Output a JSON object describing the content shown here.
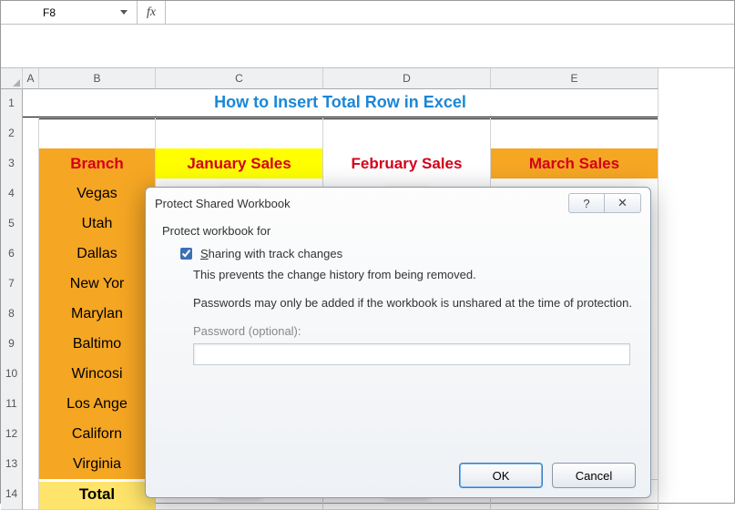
{
  "formula_bar": {
    "name_box": "F8",
    "fx_label": "fx",
    "formula_value": ""
  },
  "columns": [
    "A",
    "B",
    "C",
    "D",
    "E"
  ],
  "row_numbers": [
    "1",
    "2",
    "3",
    "4",
    "5",
    "6",
    "7",
    "8",
    "9",
    "10",
    "11",
    "12",
    "13",
    "14"
  ],
  "title": "How to Insert Total Row in Excel",
  "headers": {
    "branch": "Branch",
    "jan": "January Sales",
    "feb": "February Sales",
    "mar": "March Sales"
  },
  "branches": [
    "Vegas",
    "Utah",
    "Dallas",
    "New Yor",
    "Marylan",
    "Baltimo",
    "Wincosi",
    "Los Ange",
    "Californ",
    "Virginia"
  ],
  "total_label": "Total",
  "dialog": {
    "title": "Protect Shared Workbook",
    "help_tip": "?",
    "close_tip": "✕",
    "group_label": "Protect workbook for",
    "checkbox_label_pre": "S",
    "checkbox_label_rest": "haring with track changes",
    "checkbox_checked": true,
    "desc1": "This prevents the change history from being removed.",
    "desc2": "Passwords may only be added if the workbook is unshared at the time of protection.",
    "password_label": "Password (optional):",
    "password_value": "",
    "ok": "OK",
    "cancel": "Cancel"
  }
}
